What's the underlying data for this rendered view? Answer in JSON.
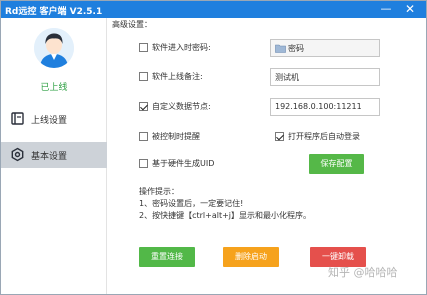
{
  "window": {
    "title": "Rd远控  客户端 V2.5.1",
    "min_icon": "minimize-icon",
    "close_icon": "close-icon",
    "accent": "#1f7fde"
  },
  "sidebar": {
    "status": "已上线",
    "status_color": "#2ea043",
    "items": [
      {
        "label": "上线设置",
        "icon": "book-icon",
        "active": false
      },
      {
        "label": "基本设置",
        "icon": "settings-icon",
        "active": true
      }
    ]
  },
  "content": {
    "section_title": "高级设置：",
    "options": {
      "password": {
        "label": "软件进入时密码:",
        "checked": false,
        "value": "密码"
      },
      "remark": {
        "label": "软件上线备注:",
        "checked": false,
        "value": "测试机"
      },
      "custom_node": {
        "label": "自定义数据节点:",
        "checked": true,
        "value": "192.168.0.100:11211"
      },
      "control_alert": {
        "label": "被控制时提醒",
        "checked": false
      },
      "autostart": {
        "label": "打开程序后自动登录",
        "checked": true
      },
      "hardware_uid": {
        "label": "基于硬件生成UID",
        "checked": false
      }
    },
    "save_label": "保存配置",
    "tips": {
      "title": "操作提示：",
      "line1": "1、密码设置后，一定要记住!",
      "line2": "2、按快捷键【ctrl+alt+j】显示和最小化程序。"
    },
    "buttons": {
      "reset": "重置连接",
      "delete_autostart": "删除启动",
      "uninstall": "一键卸载"
    }
  },
  "watermark": "知乎 @哈哈哈"
}
